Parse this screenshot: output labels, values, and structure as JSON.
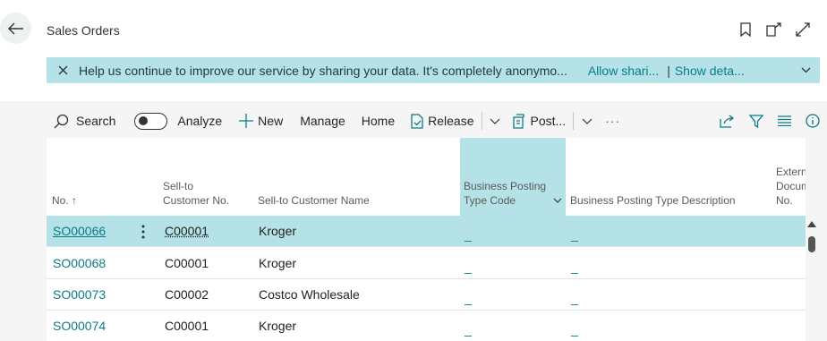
{
  "page": {
    "title": "Sales Orders"
  },
  "banner": {
    "message": "Help us continue to improve our service by sharing your data. It's completely anonymo...",
    "allow_label": "Allow shari...",
    "separator": "|",
    "show_label": "Show deta..."
  },
  "toolbar": {
    "search": "Search",
    "analyze": "Analyze",
    "new": "New",
    "manage": "Manage",
    "home": "Home",
    "release": "Release",
    "post": "Post...",
    "more": "···"
  },
  "columns": {
    "no": "No. ↑",
    "sell_to_no_1": "Sell-to",
    "sell_to_no_2": "Customer No.",
    "sell_to_name": "Sell-to Customer Name",
    "bpt_code_1": "Business Posting",
    "bpt_code_2": "Type Code",
    "bpt_desc": "Business Posting Type Description",
    "ext_1": "External",
    "ext_2": "Document",
    "ext_3": "No."
  },
  "rows": [
    {
      "no": "SO00066",
      "customer_no": "C00001",
      "customer_name": "Kroger",
      "bpt_code": "_",
      "bpt_desc": "_"
    },
    {
      "no": "SO00068",
      "customer_no": "C00001",
      "customer_name": "Kroger",
      "bpt_code": "_",
      "bpt_desc": "_"
    },
    {
      "no": "SO00073",
      "customer_no": "C00002",
      "customer_name": "Costco Wholesale",
      "bpt_code": "_",
      "bpt_desc": "_"
    },
    {
      "no": "SO00074",
      "customer_no": "C00001",
      "customer_name": "Kroger",
      "bpt_code": "_",
      "bpt_desc": "_"
    }
  ],
  "colors": {
    "accent": "#0b7b87",
    "selection": "#b4e2e6",
    "panel": "#f5f5f5"
  },
  "icons": [
    "back-arrow-icon",
    "bookmark-icon",
    "open-new-window-icon",
    "expand-icon",
    "close-icon",
    "chevron-down-icon",
    "search-icon",
    "plus-icon",
    "release-document-icon",
    "post-document-icon",
    "share-icon",
    "filter-icon",
    "list-view-icon",
    "info-icon",
    "row-menu-icon",
    "sort-ascending-icon",
    "scroll-up-icon"
  ]
}
